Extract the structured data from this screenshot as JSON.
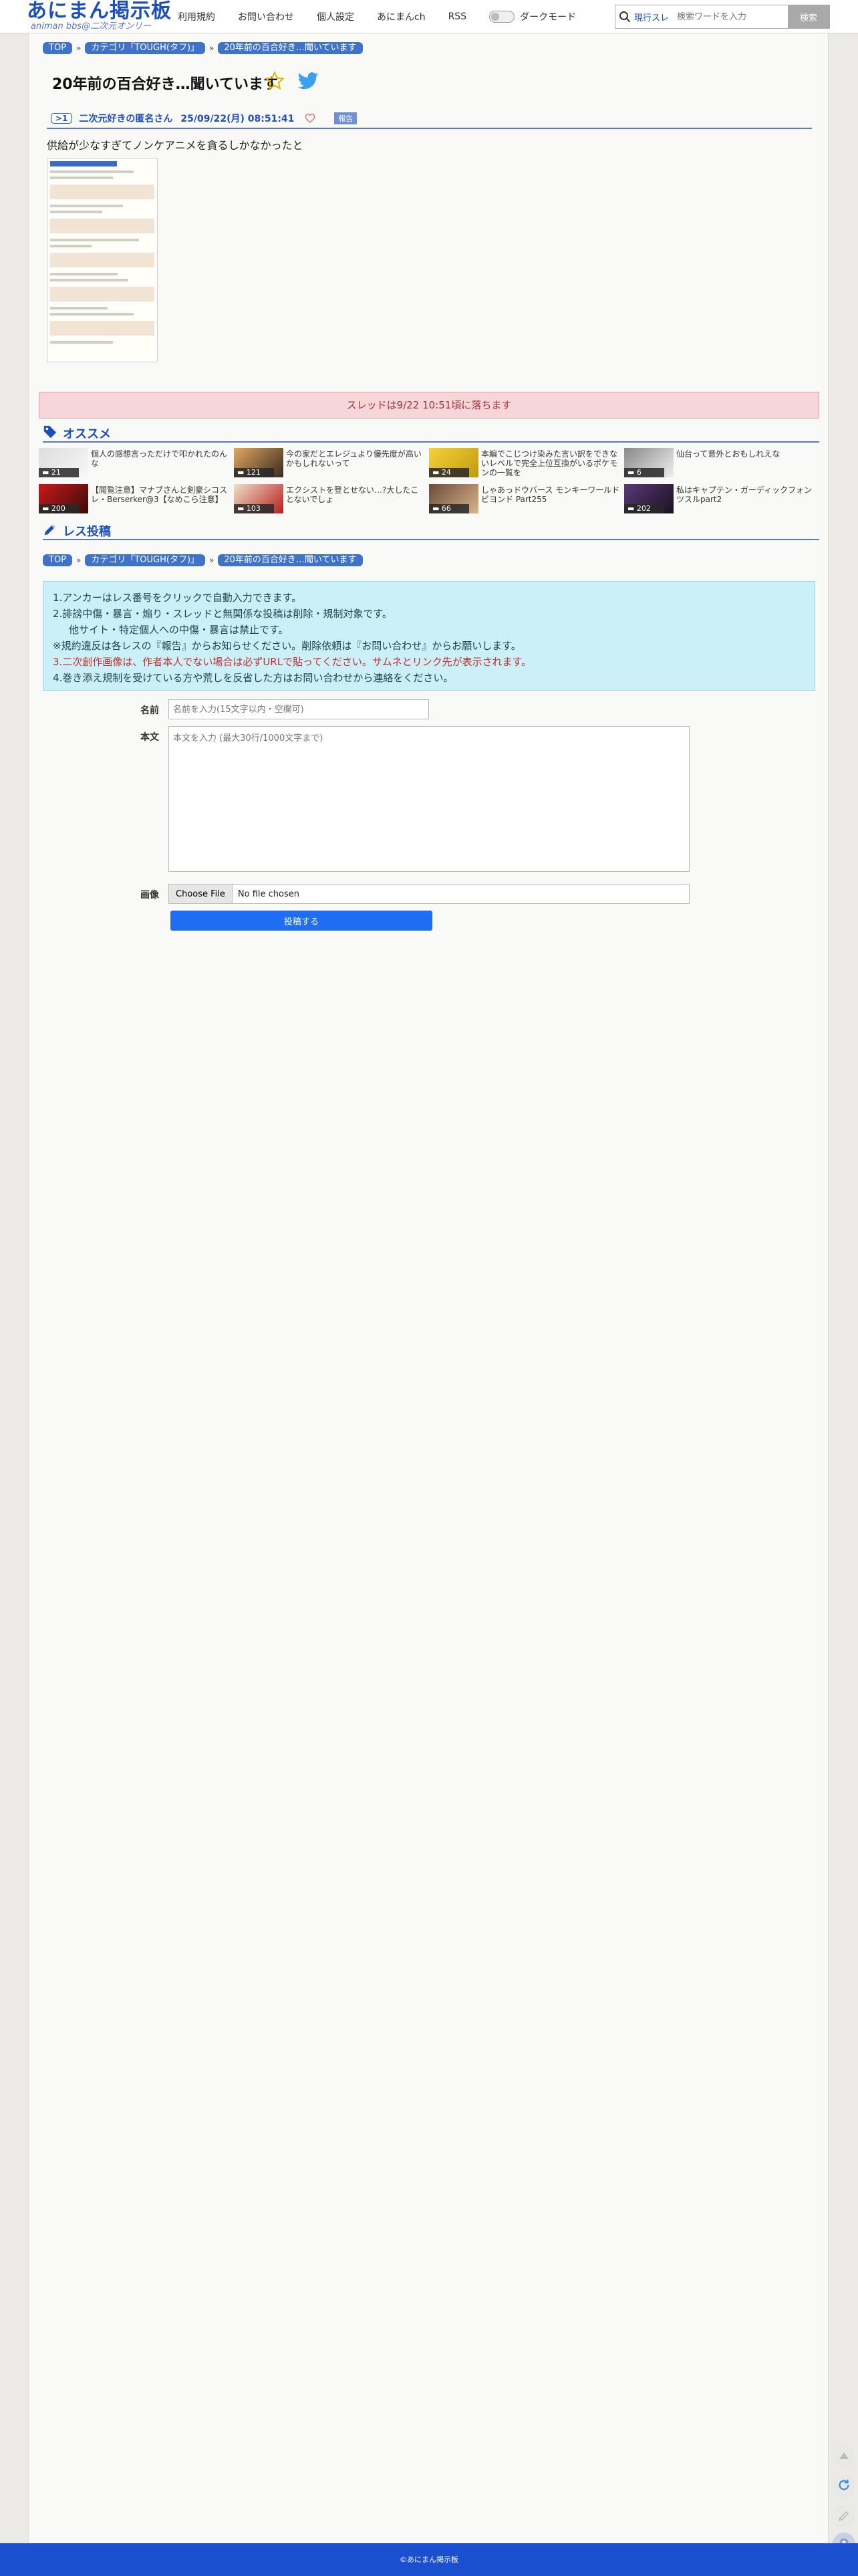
{
  "header": {
    "logo": "あにまん掲示板",
    "logo_sub": "animan bbs@二次元オンリー",
    "nav": [
      "利用規約",
      "お問い合わせ",
      "個人設定",
      "あにまんch",
      "RSS"
    ],
    "dark_mode": "ダークモード",
    "search_scope": "現行スレ",
    "search_placeholder": "検索ワードを入力",
    "search_button": "検索"
  },
  "breadcrumb": [
    "TOP",
    "カテゴリ「TOUGH(タフ)」",
    "20年前の百合好き…聞いています"
  ],
  "thread": {
    "title": "20年前の百合好き…聞いています",
    "res_number": ">1",
    "poster": "二次元好きの匿名さん",
    "date": "25/09/22(月) 08:51:41",
    "report": "報告",
    "body": "供給が少なすぎてノンケアニメを貪るしかなかったと"
  },
  "notice": "スレッドは9/22 10:51頃に落ちます",
  "recommend": {
    "heading": "オススメ",
    "items": [
      {
        "count": "21",
        "title": "個人の感想言っただけで叩かれたのんな"
      },
      {
        "count": "121",
        "title": "今の家だとエレジュより優先度が高いかもしれないって"
      },
      {
        "count": "24",
        "title": "本編でこじつけ染みた言い訳をできないレベルで完全上位互換がいるポケモンの一覧を"
      },
      {
        "count": "6",
        "title": "仙台って意外とおもしれえな"
      },
      {
        "count": "200",
        "title": "【閲覧注意】マナブさんと剣豪シコスレ・Berserker@3【なめこら注意】"
      },
      {
        "count": "103",
        "title": "エクシストを登とせない…?大したことないでしょ"
      },
      {
        "count": "66",
        "title": "しゃあっドウバース モンキーワールドビヨンド Part255"
      },
      {
        "count": "202",
        "title": "私はキャプテン・ガーディックフォンツスルpart2"
      }
    ]
  },
  "reply": {
    "heading": "レス投稿",
    "rules": [
      "1.アンカーはレス番号をクリックで自動入力できます。",
      "2.誹謗中傷・暴言・煽り・スレッドと無関係な投稿は削除・規制対象です。",
      "他サイト・特定個人への中傷・暴言は禁止です。",
      "※規約違反は各レスの『報告』からお知らせください。削除依頼は『お問い合わせ』からお願いします。",
      "3.二次創作画像は、作者本人でない場合は必ずURLで貼ってください。サムネとリンク先が表示されます。",
      "4.巻き添え規制を受けている方や荒しを反省した方はお問い合わせから連絡をください。"
    ],
    "name_label": "名前",
    "name_placeholder": "名前を入力(15文字以内・空欄可)",
    "body_label": "本文",
    "body_placeholder": "本文を入力 (最大30行/1000文字まで)",
    "image_label": "画像",
    "file_button": "Choose File",
    "file_status": "No file chosen",
    "submit": "投稿する"
  },
  "footer": "©あにまん掲示板",
  "colors": {
    "brand": "#1d4fb8",
    "pill": "#3f72c9",
    "notice_bg": "#f6d6d8",
    "rules_bg": "#cbf0f8",
    "submit": "#1f6df2"
  }
}
